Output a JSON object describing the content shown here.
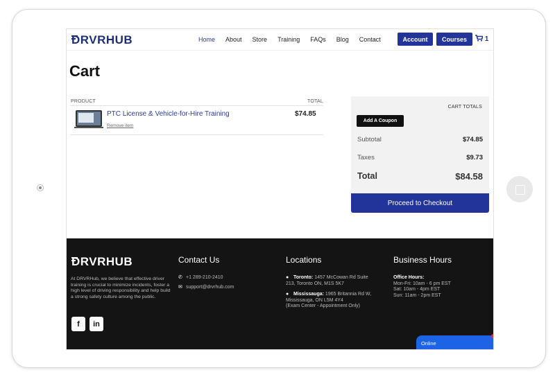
{
  "nav": {
    "logo": "DRVRHUB",
    "links": [
      "Home",
      "About",
      "Store",
      "Training",
      "FAQs",
      "Blog",
      "Contact"
    ],
    "account": "Account",
    "courses": "Courses",
    "cart_count": "1"
  },
  "page": {
    "title": "Cart"
  },
  "cart": {
    "col_product": "PRODUCT",
    "col_total": "TOTAL",
    "item_name": "PTC License & Vehicle-for-Hire Training",
    "remove": "Remove item",
    "item_price": "$74.85"
  },
  "totals": {
    "title": "CART TOTALS",
    "coupon": "Add A Coupon",
    "subtotal_label": "Subtotal",
    "subtotal": "$74.85",
    "taxes_label": "Taxes",
    "taxes": "$9.73",
    "total_label": "Total",
    "total": "$84.58",
    "checkout": "Proceed to Checkout"
  },
  "footer": {
    "logo": "DRVRHUB",
    "description": "At DRVRHub, we believe that effective driver training is crucial to minimize incidents, foster a high level of driving responsibility and help build a strong safety culture among the public.",
    "contact_title": "Contact Us",
    "phone": "+1 289-210-2410",
    "email": "support@drvrhub.com",
    "locations_title": "Locations",
    "toronto_label": "Toronto:",
    "toronto_addr_1": "1457 McCowan Rd Suite",
    "toronto_addr_2": "213, Toronto ON, M1S 5K7",
    "miss_label": "Mississauga:",
    "miss_addr_1": "1965 Britannia Rd W,",
    "miss_addr_2": "Mississauga, ON L5M 4Y4",
    "miss_addr_3": "(Exam Center - Appointment Only)",
    "hours_title": "Business Hours",
    "office_hours": "Office Hours:",
    "hours_1": "Mon-Fri: 10am - 6 pm EST",
    "hours_2": "Sat: 10am - 4pm EST",
    "hours_3": "Sun: 11am - 2pm EST",
    "facebook": "f",
    "linkedin": "in"
  },
  "chat": {
    "status": "Online"
  },
  "colors": {
    "brand_navy": "#22349a",
    "footer_bg": "#141414",
    "chat_blue": "#1d63e6"
  }
}
